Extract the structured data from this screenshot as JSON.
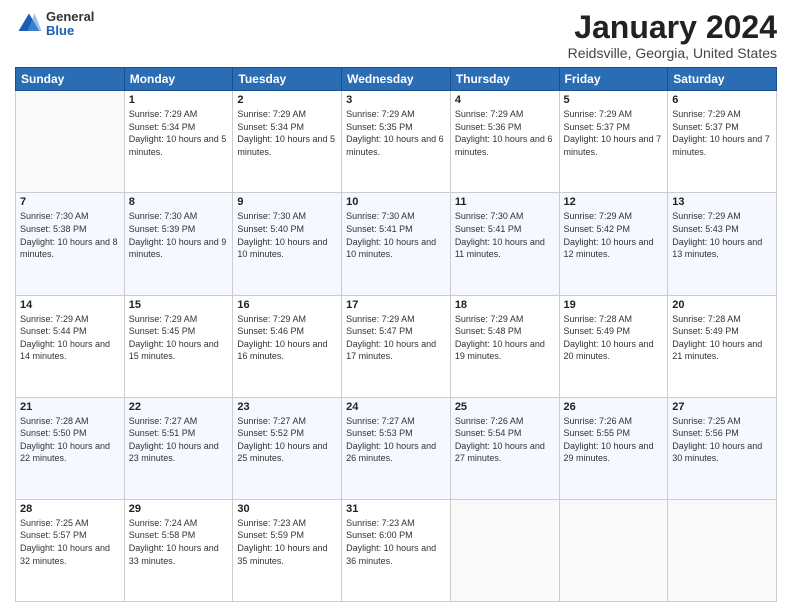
{
  "header": {
    "logo": {
      "general": "General",
      "blue": "Blue"
    },
    "title": "January 2024",
    "subtitle": "Reidsville, Georgia, United States"
  },
  "days_of_week": [
    "Sunday",
    "Monday",
    "Tuesday",
    "Wednesday",
    "Thursday",
    "Friday",
    "Saturday"
  ],
  "weeks": [
    [
      {
        "num": "",
        "sunrise": "",
        "sunset": "",
        "daylight": ""
      },
      {
        "num": "1",
        "sunrise": "Sunrise: 7:29 AM",
        "sunset": "Sunset: 5:34 PM",
        "daylight": "Daylight: 10 hours and 5 minutes."
      },
      {
        "num": "2",
        "sunrise": "Sunrise: 7:29 AM",
        "sunset": "Sunset: 5:34 PM",
        "daylight": "Daylight: 10 hours and 5 minutes."
      },
      {
        "num": "3",
        "sunrise": "Sunrise: 7:29 AM",
        "sunset": "Sunset: 5:35 PM",
        "daylight": "Daylight: 10 hours and 6 minutes."
      },
      {
        "num": "4",
        "sunrise": "Sunrise: 7:29 AM",
        "sunset": "Sunset: 5:36 PM",
        "daylight": "Daylight: 10 hours and 6 minutes."
      },
      {
        "num": "5",
        "sunrise": "Sunrise: 7:29 AM",
        "sunset": "Sunset: 5:37 PM",
        "daylight": "Daylight: 10 hours and 7 minutes."
      },
      {
        "num": "6",
        "sunrise": "Sunrise: 7:29 AM",
        "sunset": "Sunset: 5:37 PM",
        "daylight": "Daylight: 10 hours and 7 minutes."
      }
    ],
    [
      {
        "num": "7",
        "sunrise": "Sunrise: 7:30 AM",
        "sunset": "Sunset: 5:38 PM",
        "daylight": "Daylight: 10 hours and 8 minutes."
      },
      {
        "num": "8",
        "sunrise": "Sunrise: 7:30 AM",
        "sunset": "Sunset: 5:39 PM",
        "daylight": "Daylight: 10 hours and 9 minutes."
      },
      {
        "num": "9",
        "sunrise": "Sunrise: 7:30 AM",
        "sunset": "Sunset: 5:40 PM",
        "daylight": "Daylight: 10 hours and 10 minutes."
      },
      {
        "num": "10",
        "sunrise": "Sunrise: 7:30 AM",
        "sunset": "Sunset: 5:41 PM",
        "daylight": "Daylight: 10 hours and 10 minutes."
      },
      {
        "num": "11",
        "sunrise": "Sunrise: 7:30 AM",
        "sunset": "Sunset: 5:41 PM",
        "daylight": "Daylight: 10 hours and 11 minutes."
      },
      {
        "num": "12",
        "sunrise": "Sunrise: 7:29 AM",
        "sunset": "Sunset: 5:42 PM",
        "daylight": "Daylight: 10 hours and 12 minutes."
      },
      {
        "num": "13",
        "sunrise": "Sunrise: 7:29 AM",
        "sunset": "Sunset: 5:43 PM",
        "daylight": "Daylight: 10 hours and 13 minutes."
      }
    ],
    [
      {
        "num": "14",
        "sunrise": "Sunrise: 7:29 AM",
        "sunset": "Sunset: 5:44 PM",
        "daylight": "Daylight: 10 hours and 14 minutes."
      },
      {
        "num": "15",
        "sunrise": "Sunrise: 7:29 AM",
        "sunset": "Sunset: 5:45 PM",
        "daylight": "Daylight: 10 hours and 15 minutes."
      },
      {
        "num": "16",
        "sunrise": "Sunrise: 7:29 AM",
        "sunset": "Sunset: 5:46 PM",
        "daylight": "Daylight: 10 hours and 16 minutes."
      },
      {
        "num": "17",
        "sunrise": "Sunrise: 7:29 AM",
        "sunset": "Sunset: 5:47 PM",
        "daylight": "Daylight: 10 hours and 17 minutes."
      },
      {
        "num": "18",
        "sunrise": "Sunrise: 7:29 AM",
        "sunset": "Sunset: 5:48 PM",
        "daylight": "Daylight: 10 hours and 19 minutes."
      },
      {
        "num": "19",
        "sunrise": "Sunrise: 7:28 AM",
        "sunset": "Sunset: 5:49 PM",
        "daylight": "Daylight: 10 hours and 20 minutes."
      },
      {
        "num": "20",
        "sunrise": "Sunrise: 7:28 AM",
        "sunset": "Sunset: 5:49 PM",
        "daylight": "Daylight: 10 hours and 21 minutes."
      }
    ],
    [
      {
        "num": "21",
        "sunrise": "Sunrise: 7:28 AM",
        "sunset": "Sunset: 5:50 PM",
        "daylight": "Daylight: 10 hours and 22 minutes."
      },
      {
        "num": "22",
        "sunrise": "Sunrise: 7:27 AM",
        "sunset": "Sunset: 5:51 PM",
        "daylight": "Daylight: 10 hours and 23 minutes."
      },
      {
        "num": "23",
        "sunrise": "Sunrise: 7:27 AM",
        "sunset": "Sunset: 5:52 PM",
        "daylight": "Daylight: 10 hours and 25 minutes."
      },
      {
        "num": "24",
        "sunrise": "Sunrise: 7:27 AM",
        "sunset": "Sunset: 5:53 PM",
        "daylight": "Daylight: 10 hours and 26 minutes."
      },
      {
        "num": "25",
        "sunrise": "Sunrise: 7:26 AM",
        "sunset": "Sunset: 5:54 PM",
        "daylight": "Daylight: 10 hours and 27 minutes."
      },
      {
        "num": "26",
        "sunrise": "Sunrise: 7:26 AM",
        "sunset": "Sunset: 5:55 PM",
        "daylight": "Daylight: 10 hours and 29 minutes."
      },
      {
        "num": "27",
        "sunrise": "Sunrise: 7:25 AM",
        "sunset": "Sunset: 5:56 PM",
        "daylight": "Daylight: 10 hours and 30 minutes."
      }
    ],
    [
      {
        "num": "28",
        "sunrise": "Sunrise: 7:25 AM",
        "sunset": "Sunset: 5:57 PM",
        "daylight": "Daylight: 10 hours and 32 minutes."
      },
      {
        "num": "29",
        "sunrise": "Sunrise: 7:24 AM",
        "sunset": "Sunset: 5:58 PM",
        "daylight": "Daylight: 10 hours and 33 minutes."
      },
      {
        "num": "30",
        "sunrise": "Sunrise: 7:23 AM",
        "sunset": "Sunset: 5:59 PM",
        "daylight": "Daylight: 10 hours and 35 minutes."
      },
      {
        "num": "31",
        "sunrise": "Sunrise: 7:23 AM",
        "sunset": "Sunset: 6:00 PM",
        "daylight": "Daylight: 10 hours and 36 minutes."
      },
      {
        "num": "",
        "sunrise": "",
        "sunset": "",
        "daylight": ""
      },
      {
        "num": "",
        "sunrise": "",
        "sunset": "",
        "daylight": ""
      },
      {
        "num": "",
        "sunrise": "",
        "sunset": "",
        "daylight": ""
      }
    ]
  ]
}
